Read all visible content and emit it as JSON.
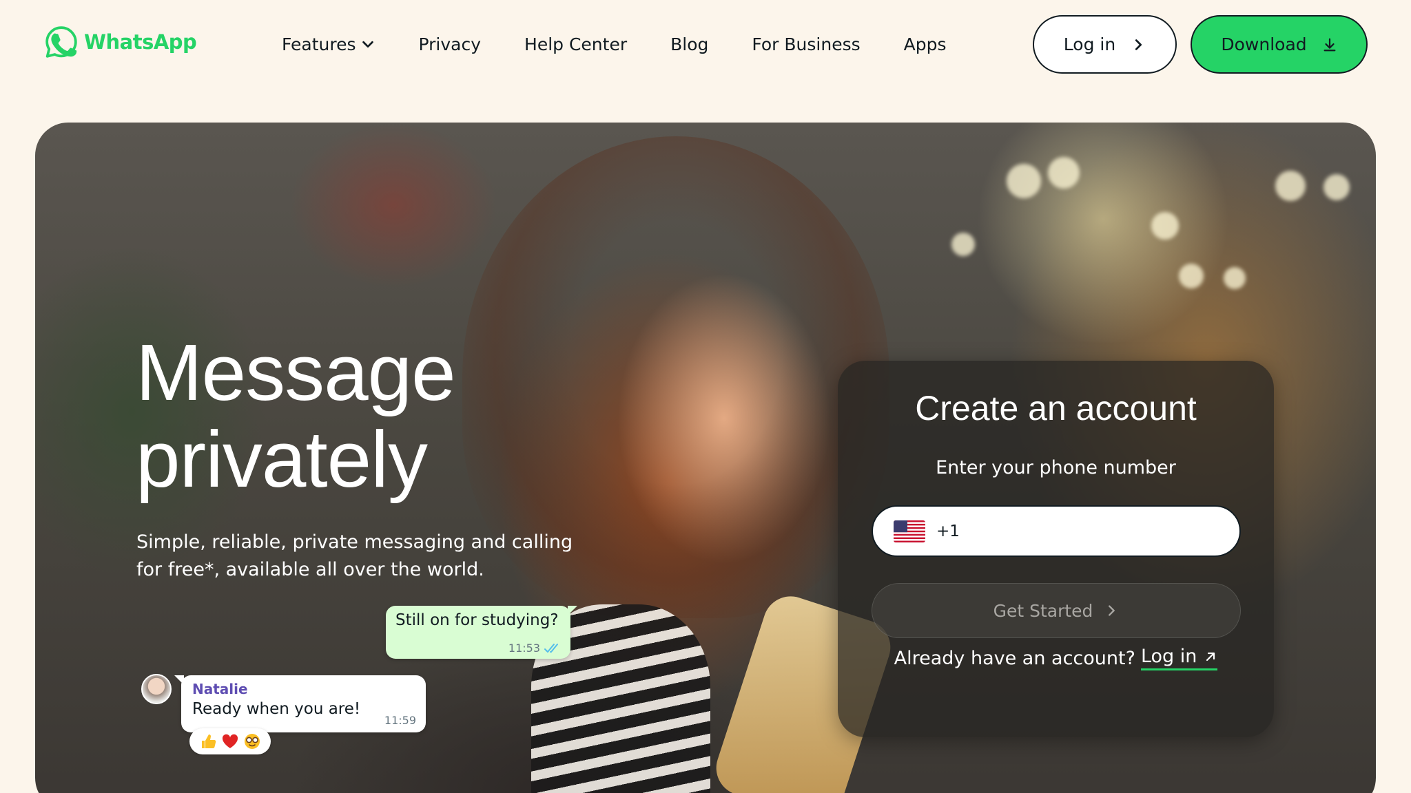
{
  "brand": {
    "name": "WhatsApp",
    "color": "#25d366"
  },
  "nav": {
    "links": [
      {
        "label": "Features",
        "has_dropdown": true
      },
      {
        "label": "Privacy"
      },
      {
        "label": "Help Center"
      },
      {
        "label": "Blog"
      },
      {
        "label": "For Business"
      },
      {
        "label": "Apps"
      }
    ],
    "login_label": "Log in",
    "download_label": "Download"
  },
  "hero": {
    "title_line1": "Message",
    "title_line2": "privately",
    "subtitle": "Simple, reliable, private messaging and calling for free*, available all over the world."
  },
  "chat": {
    "outgoing": {
      "text": "Still on for studying?",
      "time": "11:53",
      "status": "read"
    },
    "incoming": {
      "sender": "Natalie",
      "text": "Ready when you are!",
      "time": "11:59"
    },
    "reactions": [
      "thumbs-up",
      "red-heart",
      "nerd-face"
    ]
  },
  "account_card": {
    "title": "Create an account",
    "subtitle": "Enter your phone number",
    "country_flag": "us-flag",
    "dial_code": "+1",
    "phone_value": "",
    "get_started_label": "Get Started",
    "already_text": "Already have an account?",
    "login_link_label": "Log in"
  }
}
